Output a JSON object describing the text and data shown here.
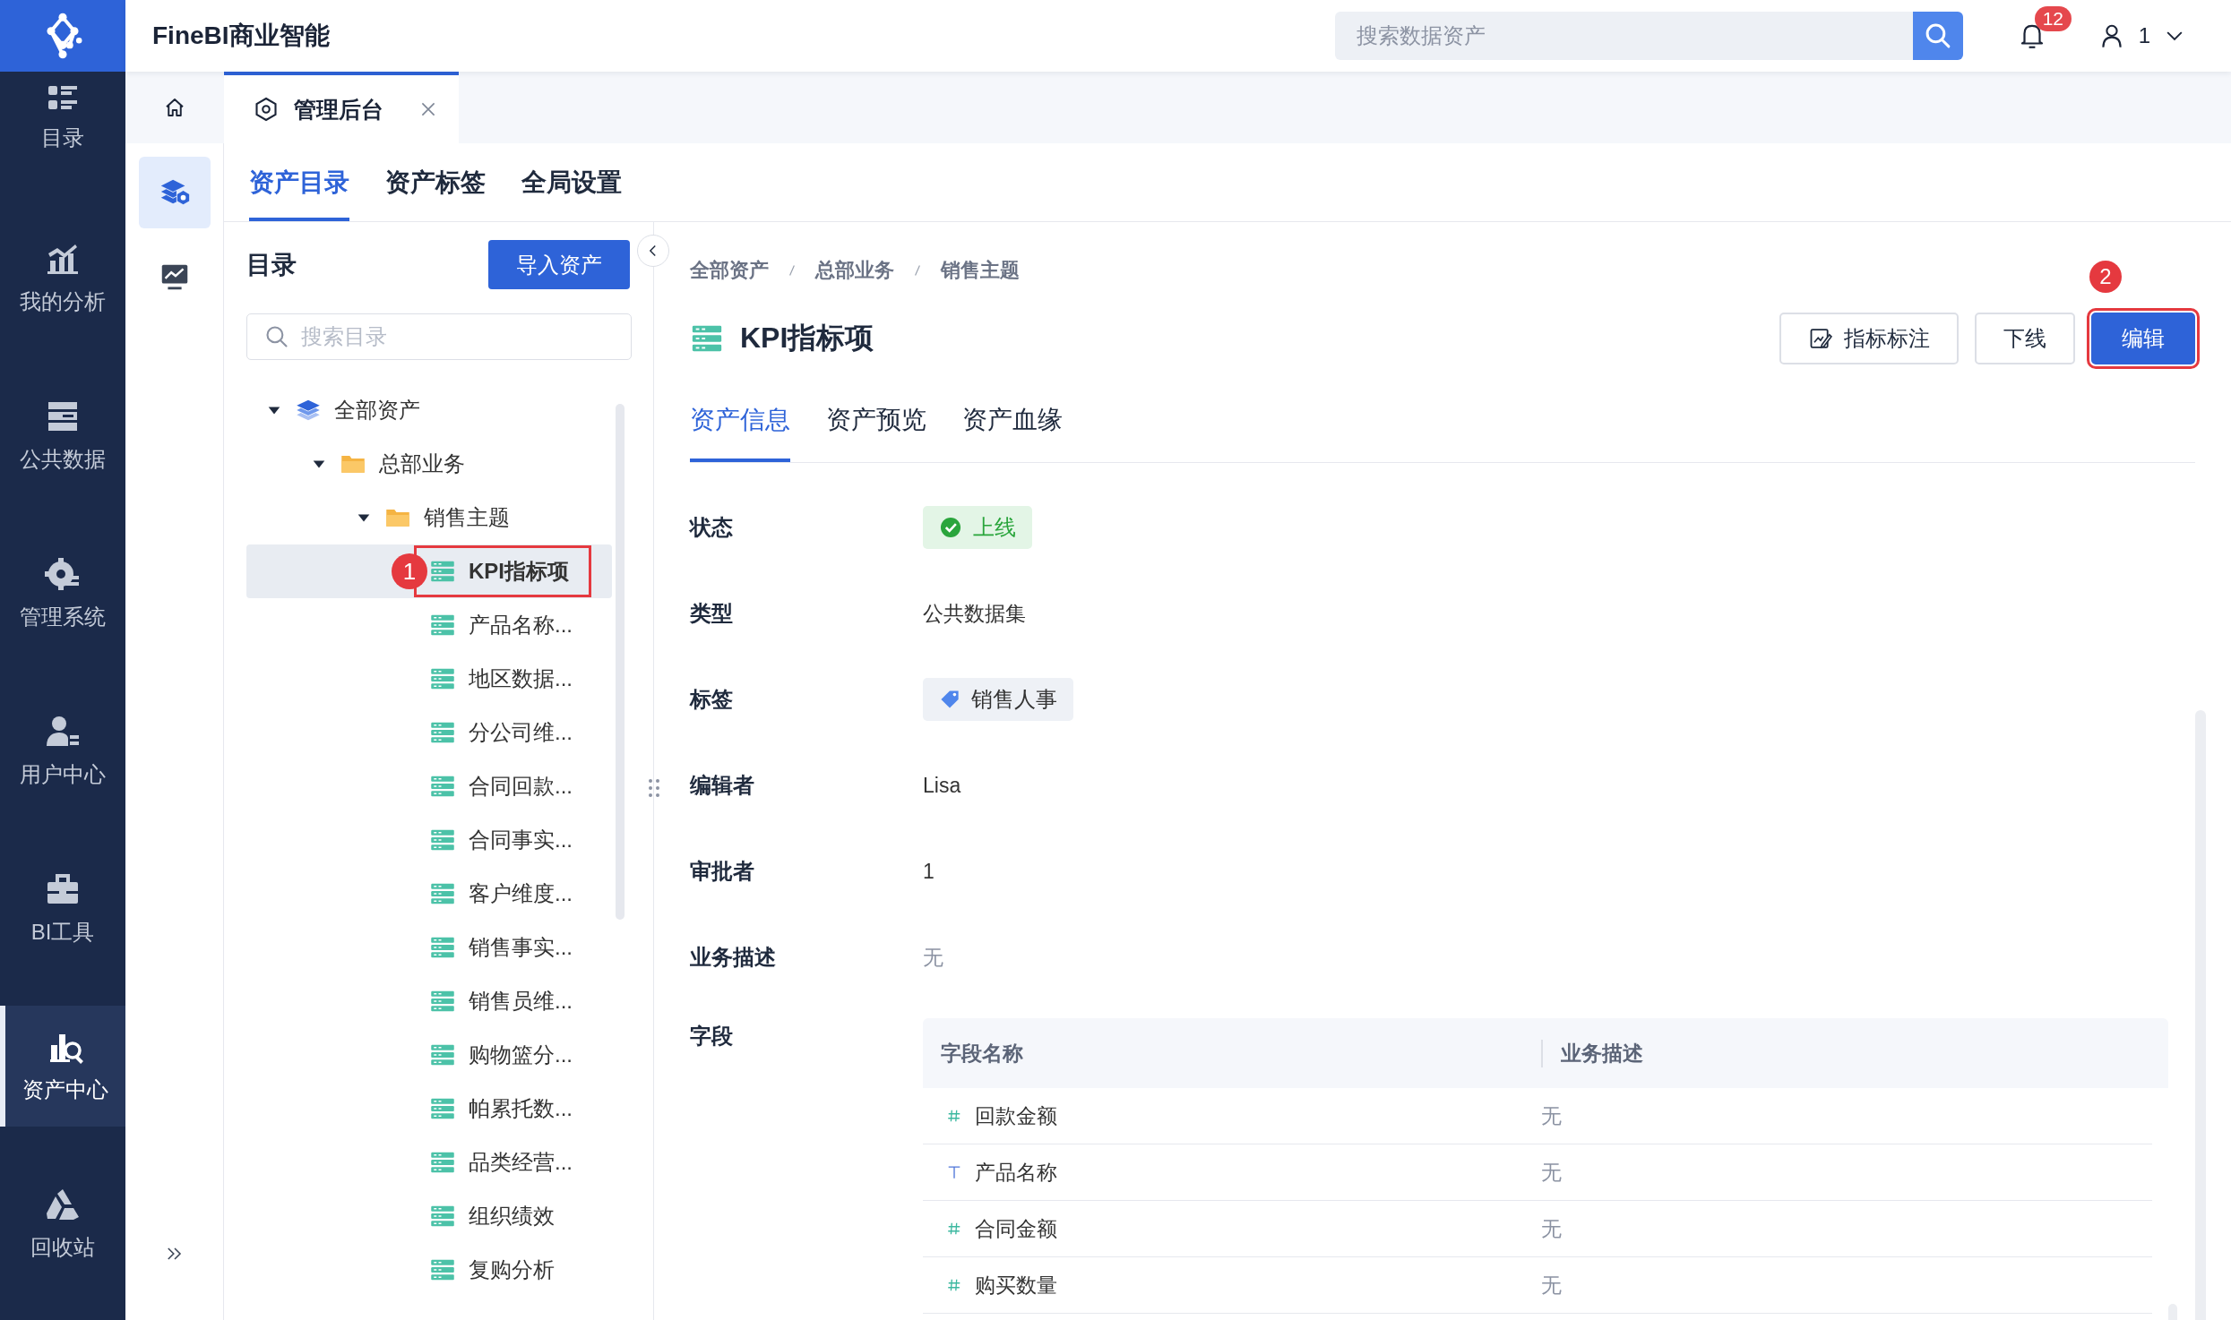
{
  "app": {
    "brand": "FineBI商业智能",
    "search_placeholder": "搜索数据资产",
    "notification_count": "12",
    "user": "1"
  },
  "nav": [
    {
      "label": "目录",
      "kind": "catalog",
      "selected": false
    },
    {
      "label": "我的分析",
      "kind": "analysis",
      "selected": false
    },
    {
      "label": "公共数据",
      "kind": "data",
      "selected": false
    },
    {
      "label": "管理系统",
      "kind": "system",
      "selected": false
    },
    {
      "label": "用户中心",
      "kind": "user",
      "selected": false
    },
    {
      "label": "BI工具",
      "kind": "tools",
      "selected": false
    },
    {
      "label": "资产中心",
      "kind": "assets",
      "selected": true
    },
    {
      "label": "回收站",
      "kind": "recycle",
      "selected": false
    }
  ],
  "page_tabs": [
    {
      "label": "管理后台",
      "selected": true
    }
  ],
  "rail": [
    {
      "kind": "assets",
      "selected": true
    },
    {
      "kind": "monitor",
      "selected": false
    }
  ],
  "sub_tabs": [
    {
      "label": "资产目录",
      "selected": true
    },
    {
      "label": "资产标签",
      "selected": false
    },
    {
      "label": "全局设置",
      "selected": false
    }
  ],
  "catalog": {
    "title": "目录",
    "import_button": "导入资产",
    "search_placeholder": "搜索目录",
    "tree": [
      {
        "label": "全部资产",
        "kind": "root",
        "expanded": true,
        "selected": false,
        "children": [
          {
            "label": "总部业务",
            "kind": "folder",
            "expanded": true,
            "selected": false,
            "children": [
              {
                "label": "销售主题",
                "kind": "folder",
                "expanded": true,
                "selected": false,
                "children": [
                  {
                    "label": "KPI指标项",
                    "kind": "table",
                    "selected": true,
                    "callout": "1"
                  },
                  {
                    "label": "产品名称...",
                    "kind": "table",
                    "selected": false
                  },
                  {
                    "label": "地区数据...",
                    "kind": "table",
                    "selected": false
                  },
                  {
                    "label": "分公司维...",
                    "kind": "table",
                    "selected": false
                  },
                  {
                    "label": "合同回款...",
                    "kind": "table",
                    "selected": false
                  },
                  {
                    "label": "合同事实...",
                    "kind": "table",
                    "selected": false
                  },
                  {
                    "label": "客户维度...",
                    "kind": "table",
                    "selected": false
                  },
                  {
                    "label": "销售事实...",
                    "kind": "table",
                    "selected": false
                  },
                  {
                    "label": "销售员维...",
                    "kind": "table",
                    "selected": false
                  },
                  {
                    "label": "购物篮分...",
                    "kind": "table",
                    "selected": false
                  },
                  {
                    "label": "帕累托数...",
                    "kind": "table",
                    "selected": false
                  },
                  {
                    "label": "品类经营...",
                    "kind": "table",
                    "selected": false
                  },
                  {
                    "label": "组织绩效",
                    "kind": "table",
                    "selected": false
                  },
                  {
                    "label": "复购分析",
                    "kind": "table",
                    "selected": false
                  }
                ]
              }
            ]
          }
        ]
      }
    ]
  },
  "detail": {
    "breadcrumb": [
      "全部资产",
      "总部业务",
      "销售主题"
    ],
    "title": "KPI指标项",
    "actions": [
      {
        "label": "指标标注",
        "kind": "annotate"
      },
      {
        "label": "下线",
        "kind": "default"
      },
      {
        "label": "编辑",
        "kind": "primary",
        "callout": "2"
      }
    ],
    "tabs": [
      {
        "label": "资产信息",
        "selected": true
      },
      {
        "label": "资产预览",
        "selected": false
      },
      {
        "label": "资产血缘",
        "selected": false
      }
    ],
    "info": [
      {
        "label": "状态",
        "kind": "status",
        "value": "上线"
      },
      {
        "label": "类型",
        "kind": "text",
        "value": "公共数据集"
      },
      {
        "label": "标签",
        "kind": "tag",
        "value": "销售人事"
      },
      {
        "label": "编辑者",
        "kind": "text",
        "value": "Lisa"
      },
      {
        "label": "审批者",
        "kind": "text",
        "value": "1"
      },
      {
        "label": "业务描述",
        "kind": "muted",
        "value": "无"
      },
      {
        "label": "字段",
        "kind": "fields"
      }
    ],
    "fields": {
      "columns": [
        "字段名称",
        "业务描述"
      ],
      "rows": [
        {
          "kind": "number",
          "name": "回款金额",
          "description": "无"
        },
        {
          "kind": "text",
          "name": "产品名称",
          "description": "无"
        },
        {
          "kind": "number",
          "name": "合同金额",
          "description": "无"
        },
        {
          "kind": "number",
          "name": "购买数量",
          "description": "无"
        }
      ]
    }
  }
}
